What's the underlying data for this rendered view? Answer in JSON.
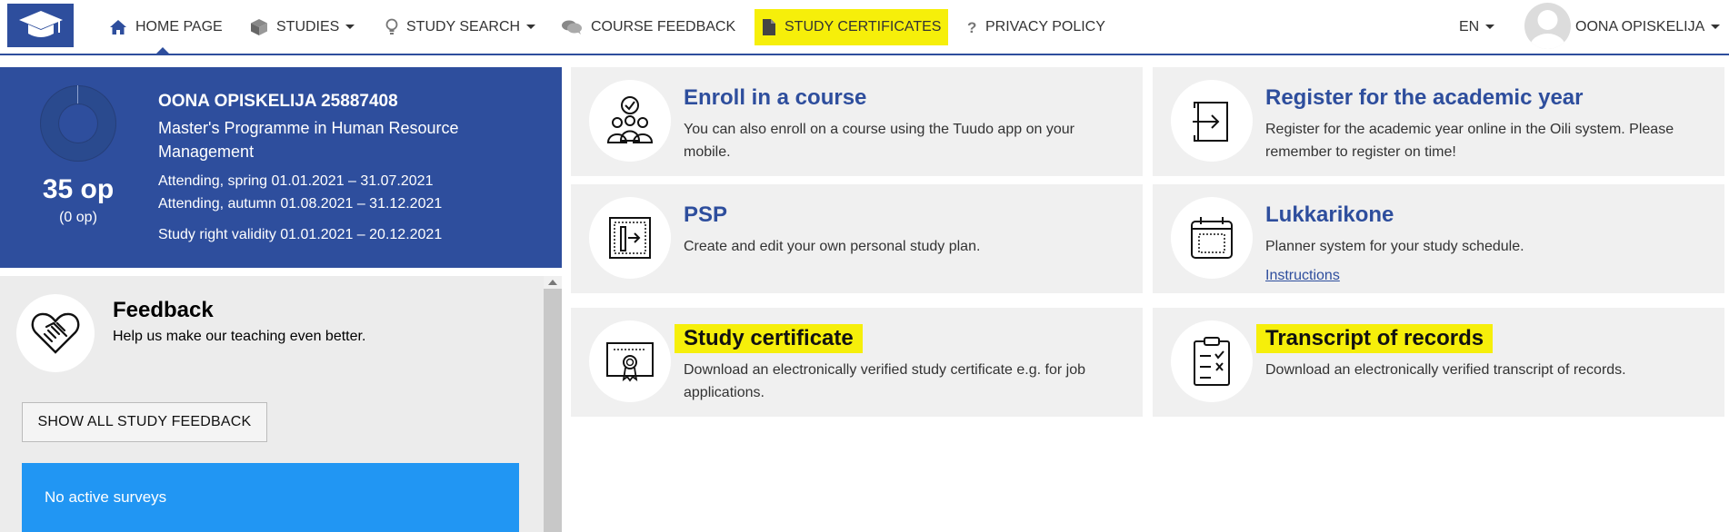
{
  "nav": {
    "items": [
      {
        "label": "HOME PAGE",
        "icon": "home-icon"
      },
      {
        "label": "STUDIES",
        "icon": "cube-icon"
      },
      {
        "label": "STUDY SEARCH",
        "icon": "lightbulb-icon"
      },
      {
        "label": "COURSE FEEDBACK",
        "icon": "chat-bubbles-icon"
      },
      {
        "label": "STUDY CERTIFICATES",
        "icon": "document-icon"
      },
      {
        "label": "PRIVACY POLICY",
        "icon": "question-icon"
      }
    ],
    "language": "EN",
    "user_name": "OONA OPISKELIJA"
  },
  "profile": {
    "name_id": "OONA OPISKELIJA 25887408",
    "programme": "Master's Programme in Human Resource Management",
    "credits": "35 op",
    "credits_sub": "(0 op)",
    "attending_spring": "Attending, spring 01.01.2021 – 31.07.2021",
    "attending_autumn": "Attending, autumn 01.08.2021 – 31.12.2021",
    "study_right": "Study right validity 01.01.2021 – 20.12.2021"
  },
  "feedback": {
    "title": "Feedback",
    "subtitle": "Help us make our teaching even better.",
    "button": "SHOW ALL STUDY FEEDBACK",
    "alert": "No active surveys"
  },
  "tiles": [
    {
      "title": "Enroll in a course",
      "desc": "You can also enroll on a course using the Tuudo app on your mobile.",
      "icon": "people-check-icon"
    },
    {
      "title": "Register for the academic year",
      "desc": "Register for the academic year online in the Oili system. Please remember to register on time!",
      "icon": "login-arrow-icon"
    },
    {
      "title": "PSP",
      "desc": "Create and edit your own personal study plan.",
      "icon": "plan-arrow-icon"
    },
    {
      "title": "Lukkarikone",
      "desc": "Planner system for your study schedule.",
      "link": "Instructions",
      "icon": "calendar-icon"
    },
    {
      "title": "Study certificate",
      "desc": "Download an electronically verified study certificate e.g. for job applications.",
      "icon": "certificate-icon"
    },
    {
      "title": "Transcript of records",
      "desc": "Download an electronically verified transcript of records.",
      "icon": "checklist-icon"
    }
  ],
  "colors": {
    "brand": "#2e4e9d",
    "highlight": "#f6ef0a",
    "alert": "#2196f3",
    "tile_bg": "#f0f0f0"
  }
}
